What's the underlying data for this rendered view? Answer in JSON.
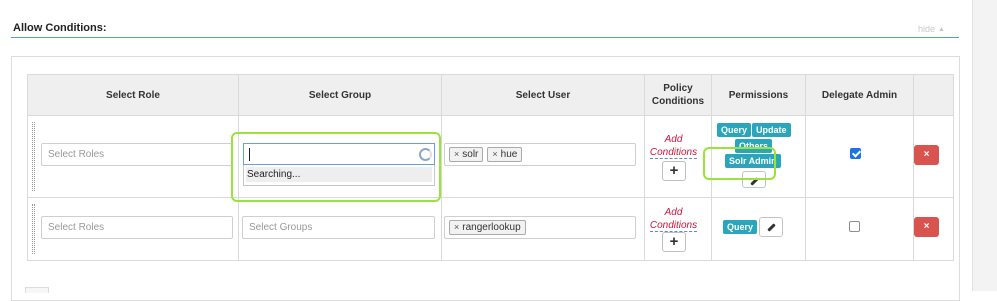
{
  "section": {
    "title": "Allow Conditions:",
    "hide_label": "hide",
    "hide_caret": "▲"
  },
  "table": {
    "headers": {
      "role": "Select Role",
      "group": "Select Group",
      "user": "Select User",
      "policy_line1": "Policy",
      "policy_line2": "Conditions",
      "permissions": "Permissions",
      "delegate": "Delegate Admin"
    },
    "rows": [
      {
        "role_placeholder": "Select Roles",
        "group_value": "",
        "group_dropdown_status": "Searching...",
        "users": [
          {
            "remove": "×",
            "label": "solr"
          },
          {
            "remove": "×",
            "label": "hue"
          }
        ],
        "add_conditions_line1": "Add",
        "add_conditions_line2": "Conditions",
        "add_button": "+",
        "permissions": [
          "Query",
          "Update",
          "Others",
          "Solr Admin"
        ],
        "delegate_admin": true,
        "delete_button": "×"
      },
      {
        "role_placeholder": "Select Roles",
        "group_placeholder": "Select Groups",
        "users": [
          {
            "remove": "×",
            "label": "rangerlookup"
          }
        ],
        "add_conditions_line1": "Add",
        "add_conditions_line2": "Conditions",
        "add_button": "+",
        "permissions": [
          "Query"
        ],
        "delegate_admin": false,
        "delete_button": "×"
      }
    ]
  },
  "colors": {
    "accent_line": "#5b9bd5",
    "permission_tag": "#2aa6bc",
    "highlight": "#9be33a",
    "delete": "#d9534f",
    "condition_link": "#d0133c"
  }
}
